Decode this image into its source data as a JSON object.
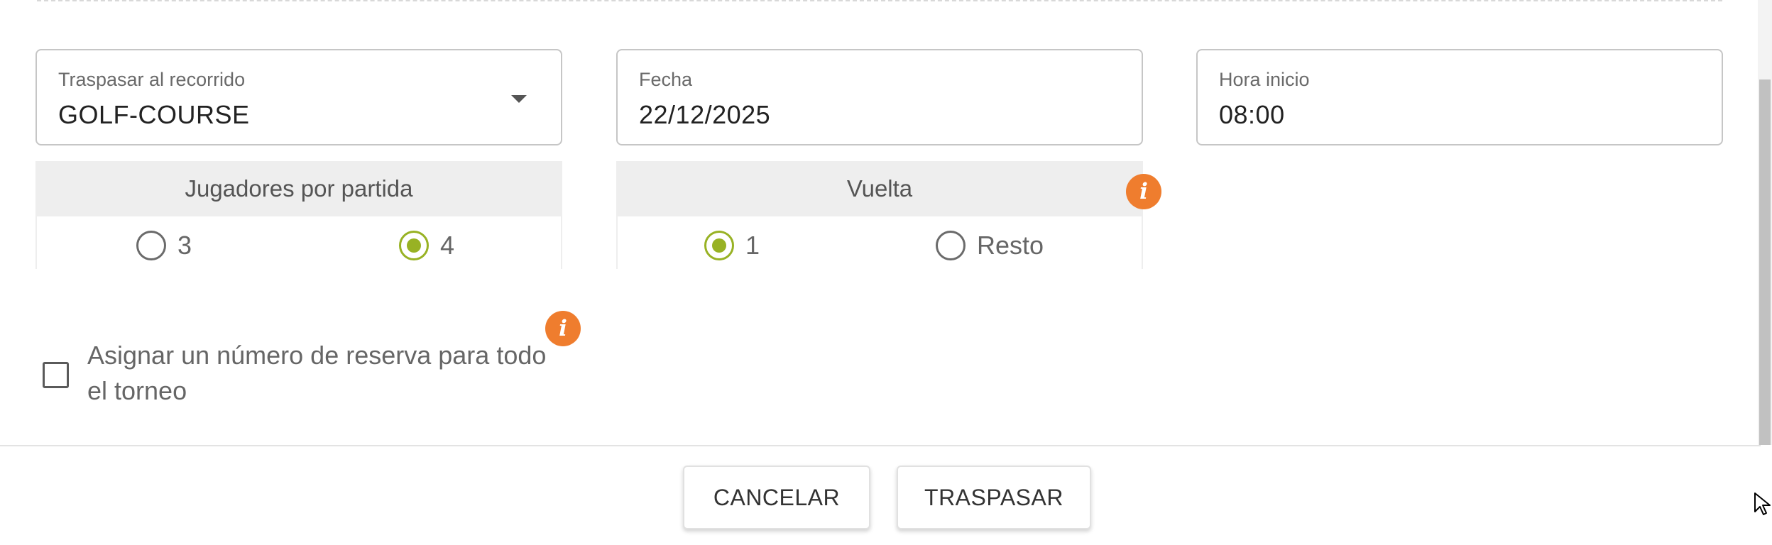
{
  "form": {
    "course": {
      "label": "Traspasar al recorrido",
      "value": "GOLF-COURSE"
    },
    "date": {
      "label": "Fecha",
      "value": "22/12/2025"
    },
    "start_time": {
      "label": "Hora inicio",
      "value": "08:00"
    }
  },
  "players_per_match": {
    "title": "Jugadores por partida",
    "options": [
      {
        "label": "3",
        "selected": false
      },
      {
        "label": "4",
        "selected": true
      }
    ]
  },
  "round": {
    "title": "Vuelta",
    "options": [
      {
        "label": "1",
        "selected": true
      },
      {
        "label": "Resto",
        "selected": false
      }
    ]
  },
  "reservation": {
    "label": "Asignar un número de reserva para todo el torneo",
    "checked": false
  },
  "buttons": {
    "cancel": "CANCELAR",
    "transfer": "TRASPASAR"
  },
  "icons": {
    "info": "i"
  },
  "colors": {
    "accent_green": "#98b224",
    "info_orange": "#ef7d2e"
  }
}
